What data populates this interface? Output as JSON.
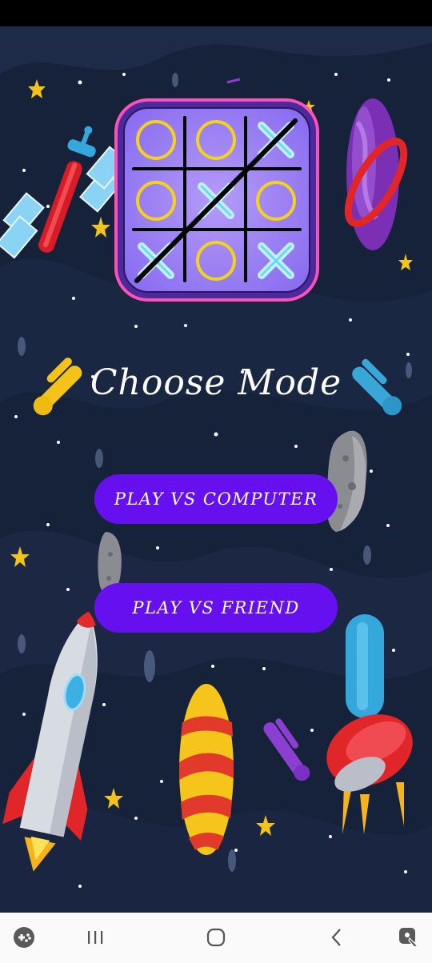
{
  "screen": {
    "title": "Choose Mode",
    "buttons": {
      "play_vs_computer": "PLAY VS COMPUTER",
      "play_vs_friend": "PLAY VS FRIEND"
    }
  },
  "colors": {
    "background": "#16223a",
    "button": "#6610ef",
    "board": "#9f83f0",
    "board_border": "#ff4fb8",
    "o_mark": "#f3d21a",
    "x_mark": "#bff2ff"
  },
  "logo": {
    "board": [
      [
        "O",
        "O",
        "X"
      ],
      [
        "O",
        "X",
        "O"
      ],
      [
        "X",
        "O",
        "X"
      ]
    ]
  },
  "nav_bar": {
    "icons": [
      "game-launcher-icon",
      "recent-apps-icon",
      "home-icon",
      "back-icon",
      "assistant-icon"
    ]
  }
}
